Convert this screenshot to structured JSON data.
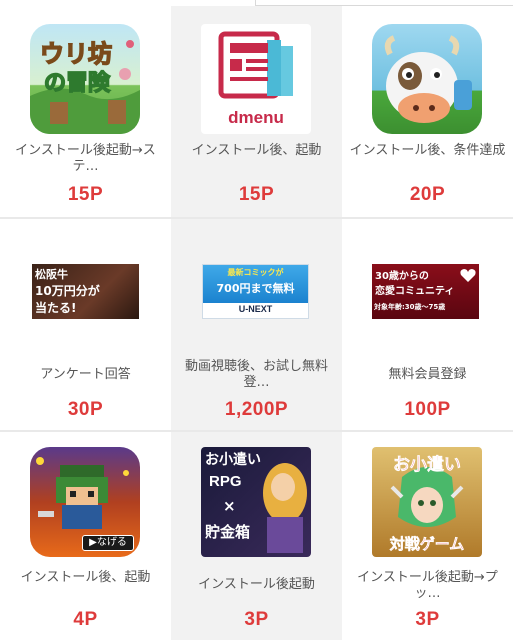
{
  "offers": [
    {
      "title": "インストール後起動→ステ…",
      "points": "15P",
      "icon": "uriboh-adventure-icon"
    },
    {
      "title": "インストール後、起動",
      "points": "15P",
      "icon": "dmenu-icon",
      "icon_text": "dmenu"
    },
    {
      "title": "インストール後、条件達成",
      "points": "20P",
      "icon": "cow-game-icon"
    },
    {
      "title": "アンケート回答",
      "points": "30P",
      "icon": "matsusaka-beef-banner",
      "banner_lines": [
        "松阪牛",
        "10万円分が",
        "当たる!"
      ]
    },
    {
      "title": "動画視聴後、お試し無料登…",
      "points": "1,200P",
      "icon": "unext-banner",
      "banner_lines": [
        "最新コミックが",
        "700円まで無料",
        "U-NEXT"
      ]
    },
    {
      "title": "無料会員登録",
      "points": "100P",
      "icon": "romance-community-banner",
      "banner_lines": [
        "30歳からの",
        "恋愛コミュニティ",
        "対象年齢:30歳〜75歳"
      ]
    },
    {
      "title": "インストール後、起動",
      "points": "4P",
      "icon": "pixel-warrior-icon",
      "icon_text": "なげる"
    },
    {
      "title": "インストール後起動",
      "points": "3P",
      "icon": "rpg-savings-icon",
      "icon_lines": [
        "お小遣い",
        "RPG",
        "×",
        "貯金箱"
      ]
    },
    {
      "title": "インストール後起動→プッ…",
      "points": "3P",
      "icon": "battle-game-icon",
      "icon_lines": [
        "お小遣い",
        "対戦ゲーム"
      ]
    }
  ],
  "colors": {
    "points": "#de3b3b",
    "cell_white": "#ffffff",
    "cell_gray": "#f2f2f2",
    "gap": "#e9e9e9"
  }
}
